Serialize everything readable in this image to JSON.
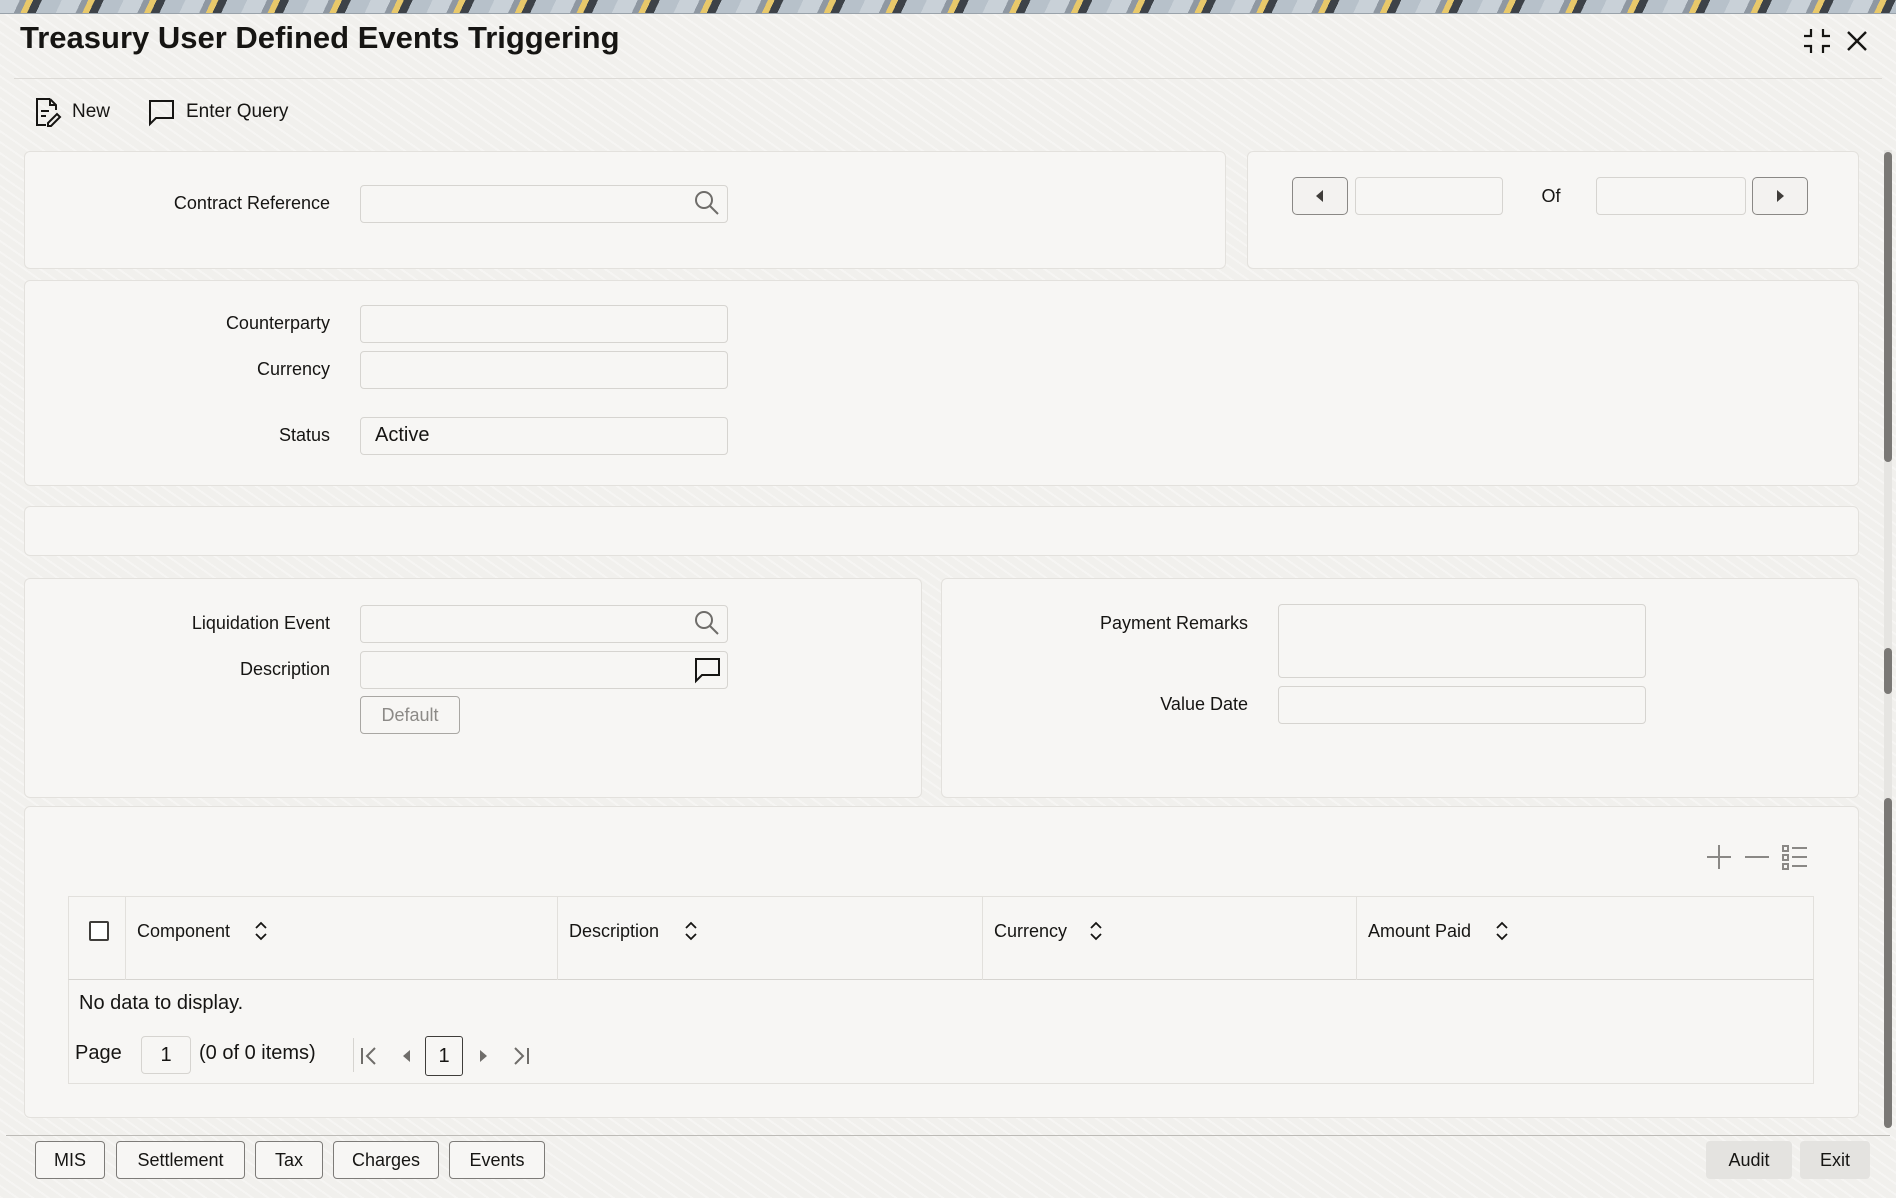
{
  "window": {
    "title": "Treasury User Defined Events Triggering"
  },
  "toolbar": {
    "new_label": "New",
    "enter_query_label": "Enter Query"
  },
  "header_section": {
    "contract_reference_label": "Contract Reference",
    "contract_reference_value": "",
    "nav_current": "",
    "nav_of_label": "Of",
    "nav_total": ""
  },
  "details": {
    "counterparty_label": "Counterparty",
    "counterparty_value": "",
    "currency_label": "Currency",
    "currency_value": "",
    "status_label": "Status",
    "status_value": "Active"
  },
  "event_section": {
    "liquidation_event_label": "Liquidation Event",
    "liquidation_event_value": "",
    "description_label": "Description",
    "description_value": "",
    "default_button_label": "Default",
    "payment_remarks_label": "Payment Remarks",
    "payment_remarks_value": "",
    "value_date_label": "Value Date",
    "value_date_value": ""
  },
  "grid": {
    "columns": [
      "Component",
      "Description",
      "Currency",
      "Amount Paid"
    ],
    "empty_message": "No data to display.",
    "page_label": "Page",
    "page_value": "1",
    "items_summary": "(0 of 0 items)",
    "current_page": "1"
  },
  "footer": {
    "buttons": [
      "MIS",
      "Settlement",
      "Tax",
      "Charges",
      "Events"
    ],
    "audit_label": "Audit",
    "exit_label": "Exit"
  }
}
